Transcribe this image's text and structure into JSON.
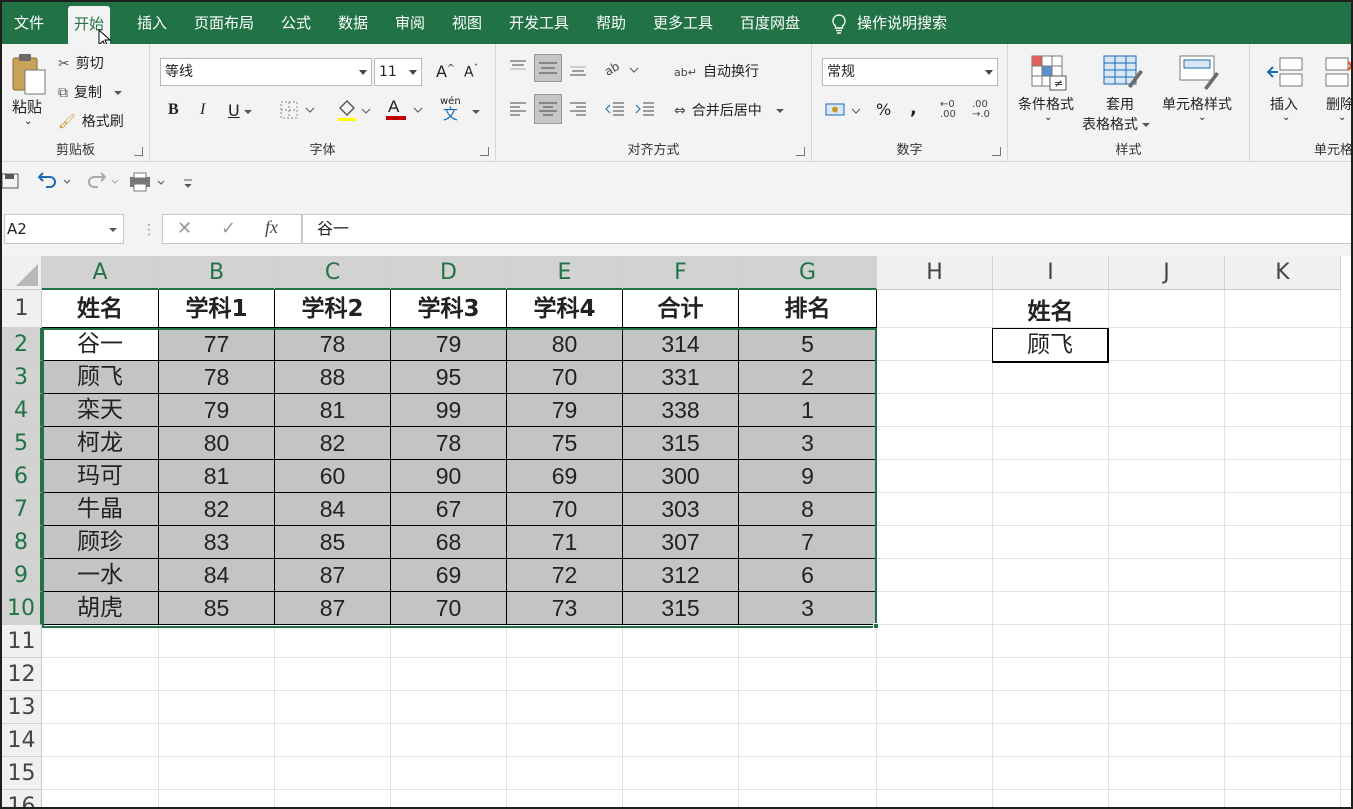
{
  "menu": {
    "tabs": [
      "文件",
      "开始",
      "插入",
      "页面布局",
      "公式",
      "数据",
      "审阅",
      "视图",
      "开发工具",
      "帮助",
      "更多工具",
      "百度网盘"
    ],
    "search": "操作说明搜索"
  },
  "ribbon": {
    "clipboard": {
      "paste": "粘贴",
      "cut": "剪切",
      "copy": "复制",
      "format_painter": "格式刷",
      "label": "剪贴板"
    },
    "font": {
      "name": "等线",
      "size": "11",
      "bold": "B",
      "italic": "I",
      "underline": "U",
      "grow": "A",
      "shrink": "A",
      "label": "字体",
      "wen": "wén",
      "wen_char": "文"
    },
    "align": {
      "wrap": "自动换行",
      "merge": "合并后居中",
      "label": "对齐方式"
    },
    "number": {
      "format": "常规",
      "percent": "%",
      "comma": ",",
      "inc_dec": ".00",
      "dec_dec": ".0",
      "label": "数字"
    },
    "styles": {
      "conditional": "条件格式",
      "table_1": "套用",
      "table_2": "表格格式",
      "cell_styles": "单元格样式",
      "label": "样式"
    },
    "cells": {
      "insert": "插入",
      "delete": "删除",
      "label": "单元格"
    }
  },
  "formula_bar": {
    "name_box": "A2",
    "fx": "fx",
    "content": "谷一"
  },
  "columns": [
    "A",
    "B",
    "C",
    "D",
    "E",
    "F",
    "G",
    "H",
    "I",
    "J",
    "K"
  ],
  "rows": [
    "1",
    "2",
    "3",
    "4",
    "5",
    "6",
    "7",
    "8",
    "9",
    "10",
    "11",
    "12",
    "13",
    "14",
    "15",
    "16"
  ],
  "table": {
    "headers": [
      "姓名",
      "学科1",
      "学科2",
      "学科3",
      "学科4",
      "合计",
      "排名"
    ],
    "rows": [
      [
        "谷一",
        "77",
        "78",
        "79",
        "80",
        "314",
        "5"
      ],
      [
        "顾飞",
        "78",
        "88",
        "95",
        "70",
        "331",
        "2"
      ],
      [
        "栾天",
        "79",
        "81",
        "99",
        "79",
        "338",
        "1"
      ],
      [
        "柯龙",
        "80",
        "82",
        "78",
        "75",
        "315",
        "3"
      ],
      [
        "玛可",
        "81",
        "60",
        "90",
        "69",
        "300",
        "9"
      ],
      [
        "牛晶",
        "82",
        "84",
        "67",
        "70",
        "303",
        "8"
      ],
      [
        "顾珍",
        "83",
        "85",
        "68",
        "71",
        "307",
        "7"
      ],
      [
        "一水",
        "84",
        "87",
        "69",
        "72",
        "312",
        "6"
      ],
      [
        "胡虎",
        "85",
        "87",
        "70",
        "73",
        "315",
        "3"
      ]
    ]
  },
  "lookup": {
    "label": "姓名",
    "value": "顾飞"
  },
  "colors": {
    "accent": "#217346",
    "selection_fill": "#c4c4c4"
  }
}
